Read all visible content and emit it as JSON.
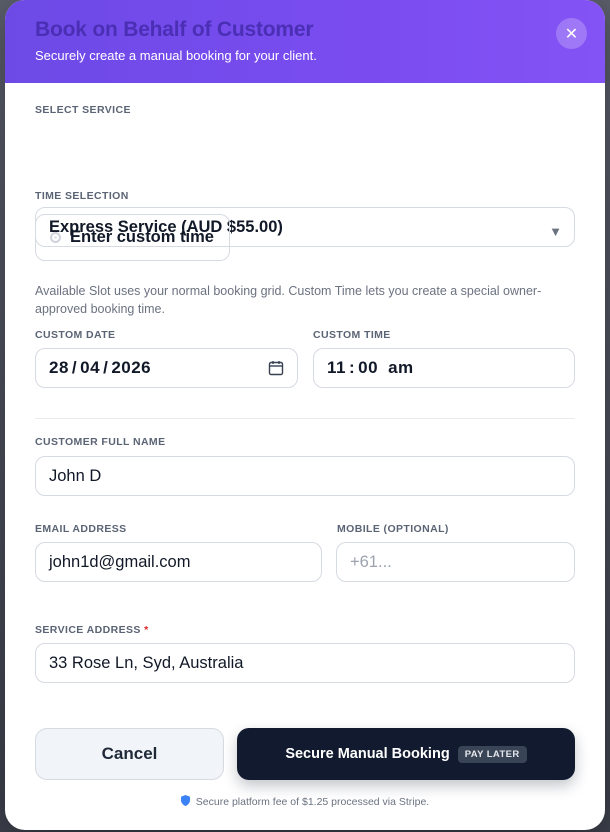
{
  "header": {
    "title": "Book on Behalf of Customer",
    "subtitle": "Securely create a manual booking for your client.",
    "close_icon": "close-icon"
  },
  "service": {
    "label": "SELECT SERVICE",
    "value": "Express Service (AUD $55.00)"
  },
  "time_selection": {
    "label": "TIME SELECTION",
    "option_label": "Enter custom time",
    "hint": "Available Slot uses your normal booking grid. Custom Time lets you create a special owner-approved booking time."
  },
  "custom_date": {
    "label": "CUSTOM DATE",
    "day": "28",
    "month": "04",
    "year": "2026"
  },
  "custom_time": {
    "label": "CUSTOM TIME",
    "hour": "11",
    "minute": "00",
    "period": "am"
  },
  "customer": {
    "name_label": "CUSTOMER FULL NAME",
    "name_value": "John D",
    "email_label": "EMAIL ADDRESS",
    "email_value": "john1d@gmail.com",
    "mobile_label": "MOBILE (OPTIONAL)",
    "mobile_placeholder": "+61..."
  },
  "address": {
    "label": "SERVICE ADDRESS",
    "required_mark": "*",
    "value": "33 Rose Ln, Syd, Australia"
  },
  "actions": {
    "cancel_label": "Cancel",
    "submit_label": "Secure Manual Booking",
    "submit_badge": "PAY LATER"
  },
  "footer": {
    "note": "Secure platform fee of $1.25 processed via Stripe."
  },
  "colors": {
    "header_gradient_start": "#6d4ae6",
    "header_gradient_end": "#8453f5",
    "primary_button": "#111a2e",
    "required": "#dc2626"
  }
}
